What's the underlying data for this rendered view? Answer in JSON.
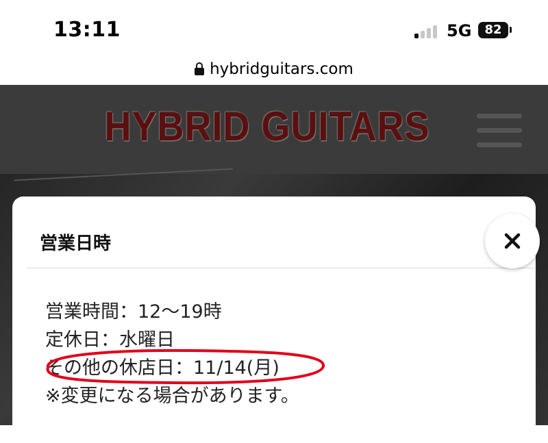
{
  "status_bar": {
    "time": "13:11",
    "network": "5G",
    "battery": "82"
  },
  "browser": {
    "url": "hybridguitars.com"
  },
  "site": {
    "logo_text": "HYBRID GUITARS"
  },
  "modal": {
    "title": "営業日時",
    "lines": [
      "営業時間：12〜19時",
      "定休日：水曜日",
      "その他の休店日：11/14(月)",
      "※変更になる場合があります。"
    ],
    "close_label": "×",
    "highlight_color": "#e0001a"
  }
}
